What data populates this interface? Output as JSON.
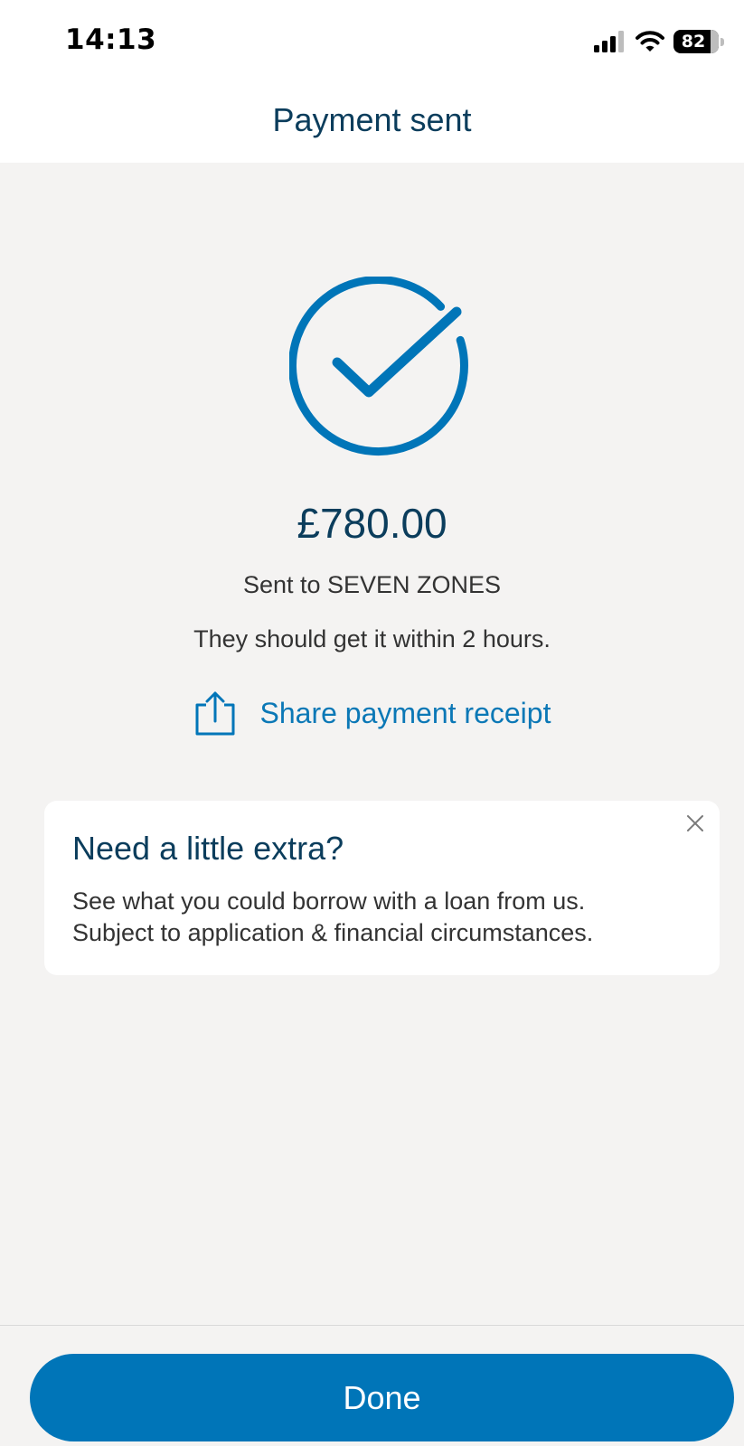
{
  "status_bar": {
    "time": "14:13",
    "battery": "82",
    "icons": [
      "signal-icon",
      "wifi-icon",
      "battery-icon"
    ]
  },
  "header": {
    "title": "Payment sent"
  },
  "confirmation": {
    "icon": "check-circle-icon",
    "amount": "£780.00",
    "sent_to": "Sent to SEVEN ZONES",
    "eta": "They should get it within 2 hours.",
    "share_icon": "share-icon",
    "share_label": "Share payment receipt"
  },
  "promo": {
    "title": "Need a little extra?",
    "line1": "See what you could borrow with a loan from us.",
    "line2": "Subject to application & financial circumstances.",
    "close_icon": "close-icon"
  },
  "footer": {
    "done_label": "Done"
  },
  "colors": {
    "accent": "#0075b8",
    "heading": "#0b3d5c",
    "background": "#f4f3f2"
  }
}
